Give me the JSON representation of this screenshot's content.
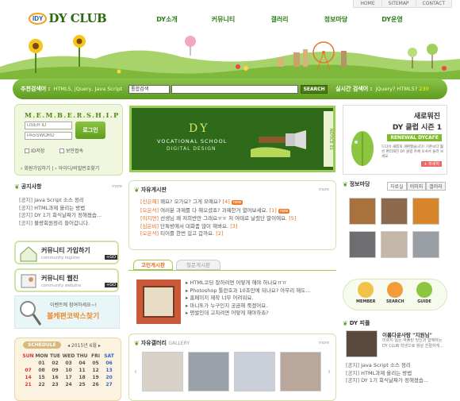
{
  "util": [
    "HOME",
    "SITEMAP",
    "CONTACT"
  ],
  "logo": {
    "badge": "IDY",
    "name": "DY CLUB"
  },
  "gnb": [
    "DY소개",
    "커뮤니티",
    "갤러리",
    "정보마당",
    "DY운영"
  ],
  "search": {
    "label": "추천검색어 :",
    "examples": "HTML5, jQuery, Java Script",
    "select_value": "통합검색",
    "button": "SEARCH",
    "realtime_label": "실시간 검색어 :",
    "hot": "jQuery? HTML5?",
    "hot_count": "230"
  },
  "login": {
    "title": "M.E.M.B.E.R.S.H.I.P",
    "user_placeholder": "USER ID",
    "password_placeholder": "PASSWORD",
    "button": "로그인",
    "save_id": "ID저장",
    "secure": "보안접속",
    "join": "회원가입하기",
    "find": "아이디/비밀번호찾기"
  },
  "banner": {
    "title": "DY",
    "line1": "VOCATIONAL SCHOOL",
    "line2": "DIGITAL DESIGN",
    "notice": "NOTICE 01",
    "side": "NOTICE 02"
  },
  "promo": {
    "line1": "새로워진",
    "line2": "DY 클럽 시즌 1",
    "tag": "RENEWAL DYCAFE",
    "desc": "드디어 새롭게 개편했습니다! 기존보다 훨씬 편리해진 DY 클럽 카페 오셔서 둘러 보세요.",
    "more": "+ 자세히"
  },
  "notice": {
    "title": "공지사항",
    "more": "more",
    "items": [
      {
        "tag": "[공지]",
        "text": "Java Script 소스 정리"
      },
      {
        "tag": "[공지]",
        "text": "HTML과제 올리는 방법"
      },
      {
        "tag": "[공지]",
        "text": "DY 1기 회식날짜가 정해졌습..."
      },
      {
        "tag": "[공지]",
        "text": "불량회원정리 들어갑니다."
      }
    ]
  },
  "free": {
    "title": "자유게시판",
    "more": "more",
    "items": [
      {
        "tag": "[신은혜]",
        "text": "왜요? 오가요? 그게 모예요?",
        "count": "[4]",
        "badge": "new"
      },
      {
        "tag": "[오은석]",
        "text": "여러분 과제를 다 해오셨죠? 과제한거 열어보세요.",
        "count": "[1]",
        "badge": "new"
      },
      {
        "tag": "[이지연]",
        "text": "선생님 왜 저희반만 그래요ㅠㅠ 저 여태로 날렸단 말이에요.",
        "count": "[5]",
        "badge": ""
      },
      {
        "tag": "[심은비]",
        "text": "단톡방에서 대화좀 많이 해봐요.",
        "count": "[3]",
        "badge": ""
      },
      {
        "tag": "[오은석]",
        "text": "티어를 한번 걸고 갑까요.",
        "count": "[2]",
        "badge": ""
      }
    ]
  },
  "tabs": {
    "active": "고민게시판",
    "inactive": "질문게시판"
  },
  "qa": [
    "HTML코딩 잘하려면 어떻게 해야 하나요ㅠㅠ",
    "Photoshop 툴란호과 10초만에 되나요? 아무리 해도...",
    "홈페이지 제작 너무 어려워요.",
    "마니또가 누구인지 궁금해 죽겠어요.",
    "평발인데 고치려면 어떻게 해야하죠?"
  ],
  "community": [
    {
      "title": "커뮤니티 가입하기",
      "sub": "community register",
      "tag": "+GO"
    },
    {
      "title": "커뮤니티 웹진",
      "sub": "community webzine",
      "tag": "+GO"
    }
  ],
  "event": {
    "line1": "이벤트에 참여하세요~!",
    "line2": "볼케편코박스찾기"
  },
  "calendar": {
    "title": "SCHEDULE",
    "month": "2015년 6월",
    "days": [
      "SUN",
      "MON",
      "TUE",
      "WED",
      "THU",
      "FRI",
      "SAT"
    ],
    "rows": [
      [
        "",
        "01",
        "02",
        "03",
        "04",
        "05",
        "06"
      ],
      [
        "07",
        "08",
        "09",
        "10",
        "11",
        "12",
        "13"
      ],
      [
        "14",
        "15",
        "16",
        "17",
        "18",
        "19",
        "20"
      ],
      [
        "21",
        "22",
        "23",
        "24",
        "25",
        "26",
        "27"
      ]
    ]
  },
  "gallery": {
    "title": "자유갤러리",
    "sub": "GALLERY",
    "more": "more"
  },
  "info": {
    "title": "정보마당",
    "tabs": [
      "자료실",
      "이미지",
      "갤러리"
    ]
  },
  "quick": [
    {
      "label": "MEMBER"
    },
    {
      "label": "SEARCH"
    },
    {
      "label": "GUIDE"
    }
  ],
  "dypeople": {
    "title": "DY 피플",
    "name": "이름다운사람 \"지원님\"",
    "desc": "미르지 잃는 억풀린 당신과 함께하는 DY CLUB 학생으로 항상 친절하게...",
    "items": [
      {
        "tag": "[공지]",
        "text": "Java Script 소스 정리"
      },
      {
        "tag": "[공지]",
        "text": "HTML과제 올리는 방법"
      },
      {
        "tag": "[공지]",
        "text": "DY 1기 회식날짜가 정해졌습..."
      }
    ]
  }
}
